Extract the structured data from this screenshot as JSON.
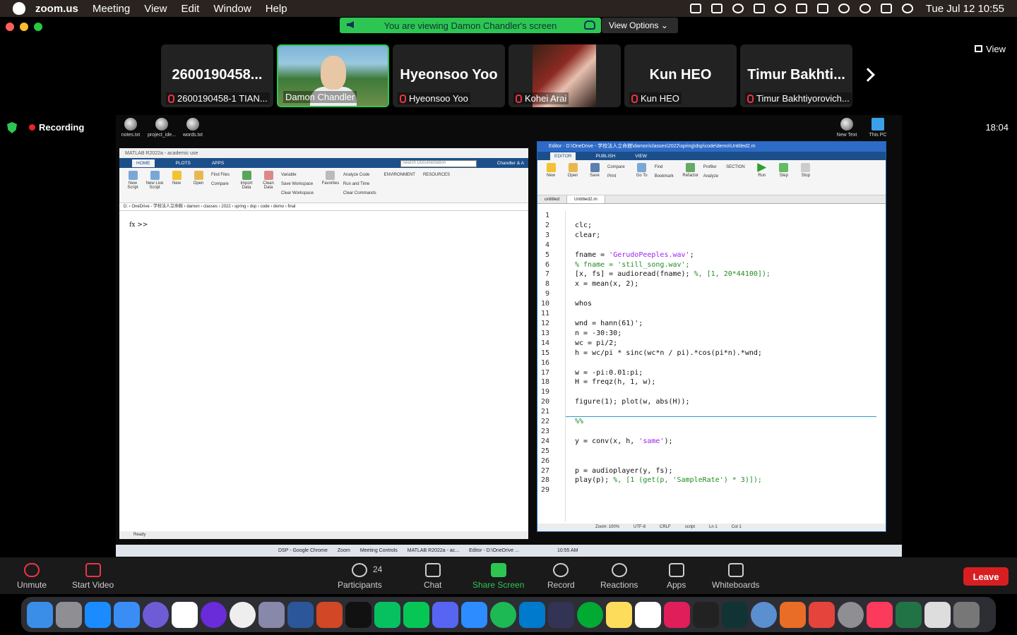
{
  "menubar": {
    "app": "zoom.us",
    "items": [
      "Meeting",
      "View",
      "Edit",
      "Window",
      "Help"
    ],
    "datetime": "Tue Jul 12  10:55"
  },
  "share_banner": {
    "text": "You are viewing Damon Chandler's screen",
    "view_options": "View Options"
  },
  "view_button": "View",
  "participants_strip": [
    {
      "big": "2600190458...",
      "name": "2600190458-1 TIAN..."
    },
    {
      "big": "",
      "name": "Damon Chandler"
    },
    {
      "big": "Hyeonsoo Yoo",
      "name": "Hyeonsoo Yoo"
    },
    {
      "big": "",
      "name": "Kohei Arai"
    },
    {
      "big": "Kun HEO",
      "name": "Kun HEO"
    },
    {
      "big": "Timur Bakhti...",
      "name": "Timur Bakhtiyorovich..."
    }
  ],
  "recording": "Recording",
  "timer": "18:04",
  "shared_screen": {
    "desktop_icons": [
      "notes.txt",
      "project_ide...",
      "words.txt",
      "New Text",
      "This PC"
    ],
    "matlab": {
      "title": "MATLAB R2022a - academic use",
      "tabs": [
        "HOME",
        "PLOTS",
        "APPS"
      ],
      "search": "Search Documentation",
      "user": "Chandler & A",
      "ribbon": [
        "New Script",
        "New Live Script",
        "New",
        "Open",
        "Find Files",
        "Compare",
        "Import Data",
        "Clean Data",
        "Variable",
        "Save Workspace",
        "Clear Workspace",
        "Favorites",
        "Analyze Code",
        "Run and Time",
        "Clear Commands",
        "ENVIRONMENT",
        "RESOURCES"
      ],
      "path": "D: › OneDrive - 学校法人立命館 › damon › classes › 2022 › spring › dsp › code › demo › final",
      "prompt": "fx >>",
      "status": "Ready"
    },
    "editor": {
      "title": "Editor - D:\\OneDrive - 学校法人立命館\\damon\\classes\\2022\\spring\\dsp\\code\\demo\\Untitled2.m",
      "tabs": [
        "EDITOR",
        "PUBLISH",
        "VIEW"
      ],
      "ribbon": [
        "New",
        "Open",
        "Save",
        "Compare",
        "Print",
        "Go To",
        "Find",
        "Bookmark",
        "Refactor",
        "Profiler",
        "Analyze",
        "SECTION",
        "Run",
        "Step",
        "Stop"
      ],
      "file_tabs": [
        "untitled",
        "Untitled2.m"
      ],
      "status": [
        "Zoom: 100%",
        "UTF-8",
        "CRLF",
        "script",
        "Ln  1",
        "Col  1"
      ]
    },
    "taskbar": [
      "DSP - Google Chrome",
      "Zoom",
      "Meeting Controls",
      "MATLAB R2022a - ac...",
      "Editor - D:\\OneDrive ...",
      "10:55 AM"
    ]
  },
  "controls": {
    "unmute": "Unmute",
    "start_video": "Start Video",
    "participants": "Participants",
    "participants_count": "24",
    "chat": "Chat",
    "share_screen": "Share Screen",
    "record": "Record",
    "reactions": "Reactions",
    "apps": "Apps",
    "whiteboards": "Whiteboards",
    "leave": "Leave"
  }
}
